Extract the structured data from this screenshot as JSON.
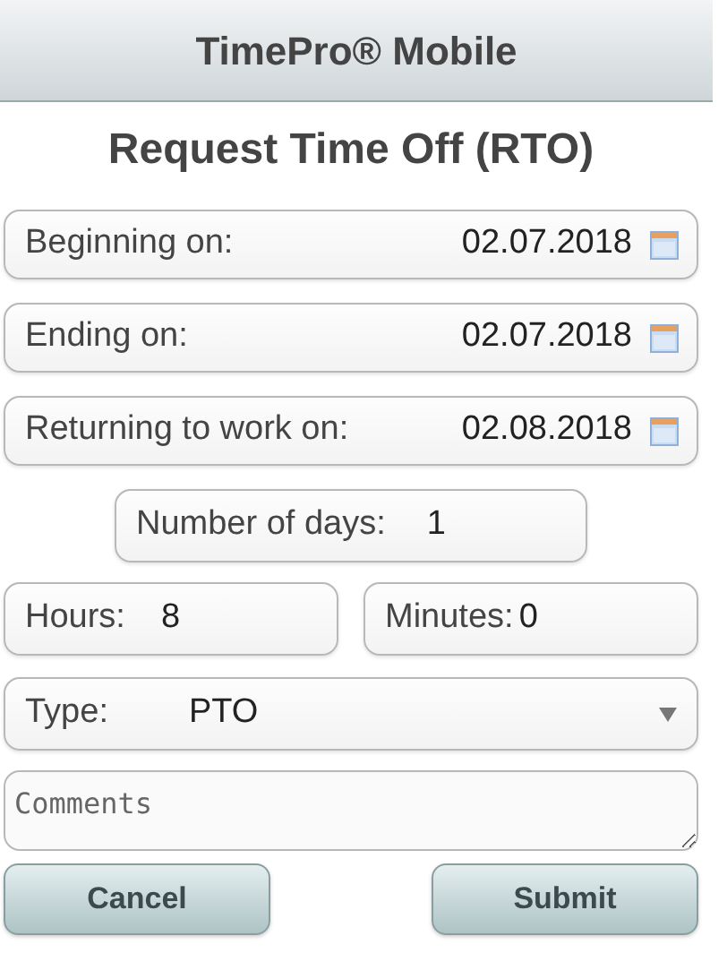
{
  "header": {
    "title": "TimePro® Mobile"
  },
  "page_title": "Request Time Off (RTO)",
  "date_fields": [
    {
      "label": "Beginning on:",
      "value": "02.07.2018"
    },
    {
      "label": "Ending on:",
      "value": "02.07.2018"
    },
    {
      "label": "Returning to work on:",
      "value": "02.08.2018"
    }
  ],
  "days": {
    "label": "Number of days:",
    "value": "1"
  },
  "hours": {
    "label": "Hours:",
    "value": "8"
  },
  "minutes": {
    "label": "Minutes:",
    "value": "0"
  },
  "type": {
    "label": "Type:",
    "value": "PTO"
  },
  "comments": {
    "placeholder": "Comments"
  },
  "buttons": [
    {
      "label": "Cancel"
    },
    {
      "label": "Submit"
    }
  ]
}
